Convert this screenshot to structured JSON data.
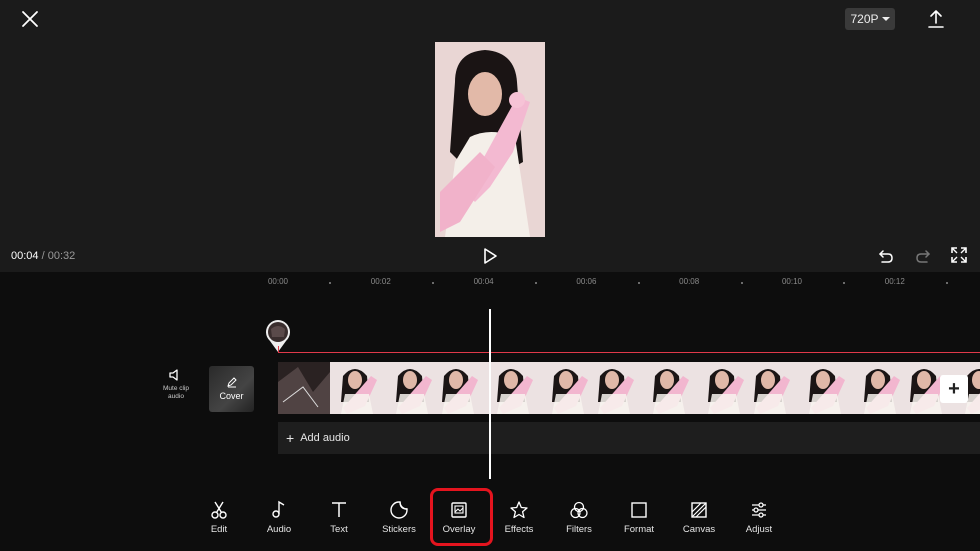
{
  "header": {
    "resolution_label": "720P"
  },
  "player": {
    "current_time": "00:04",
    "separator": " / ",
    "total_time": "00:32"
  },
  "ruler": {
    "ticks": [
      "00:00",
      "00:02",
      "00:04",
      "00:06",
      "00:08",
      "00:10",
      "00:12"
    ]
  },
  "track": {
    "mute_label_line1": "Mute clip",
    "mute_label_line2": "audio",
    "cover_label": "Cover",
    "add_audio_label": "Add audio"
  },
  "toolbar": {
    "items": [
      {
        "label": "Edit",
        "icon": "scissors-icon"
      },
      {
        "label": "Audio",
        "icon": "music-note-icon"
      },
      {
        "label": "Text",
        "icon": "text-icon"
      },
      {
        "label": "Stickers",
        "icon": "sticker-icon"
      },
      {
        "label": "Overlay",
        "icon": "overlay-icon"
      },
      {
        "label": "Effects",
        "icon": "effects-star-icon"
      },
      {
        "label": "Filters",
        "icon": "filters-icon"
      },
      {
        "label": "Format",
        "icon": "format-square-icon"
      },
      {
        "label": "Canvas",
        "icon": "canvas-icon"
      },
      {
        "label": "Adjust",
        "icon": "adjust-sliders-icon"
      }
    ],
    "selected": "Overlay"
  },
  "colors": {
    "accent_red": "#e4141e",
    "track_line": "#e0394a",
    "preview_bg": "#1b1b1b"
  }
}
